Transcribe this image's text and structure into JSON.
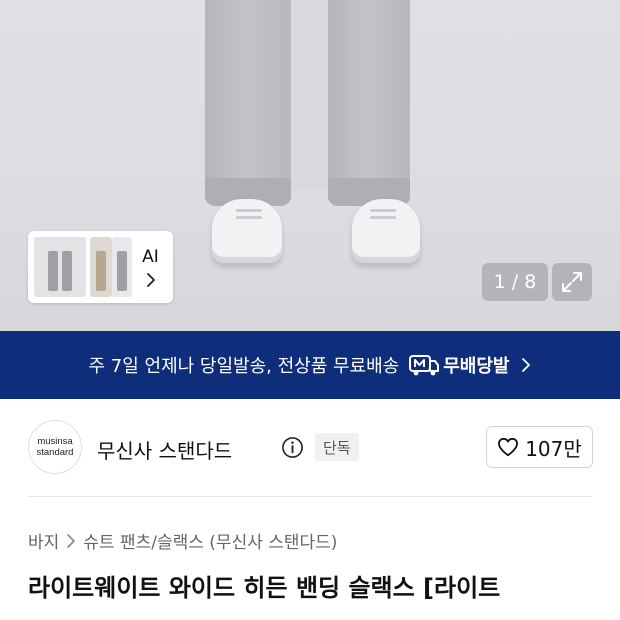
{
  "gallery": {
    "thumbnail_count_visible": 3,
    "ai_label": "AI",
    "counter": "1 / 8",
    "expand_icon": "expand-icon"
  },
  "banner": {
    "text": "주 7일 언제나 당일발송, 전상품 무료배송",
    "badge": "무배당발",
    "badge_icon": "m-truck-icon",
    "colors": {
      "background": "#0e2e7b",
      "text": "#ffffff"
    }
  },
  "brand": {
    "logo_line1": "musinsa",
    "logo_line2": "standard",
    "name": "무신사 스탠다드",
    "tag": "단독",
    "likes": "107만"
  },
  "breadcrumb": {
    "items": [
      "바지",
      "슈트 팬츠/슬랙스 (무신사 스탠다드)"
    ]
  },
  "product": {
    "title": "라이트웨이트 와이드 히든 밴딩 슬랙스 [라이트"
  }
}
